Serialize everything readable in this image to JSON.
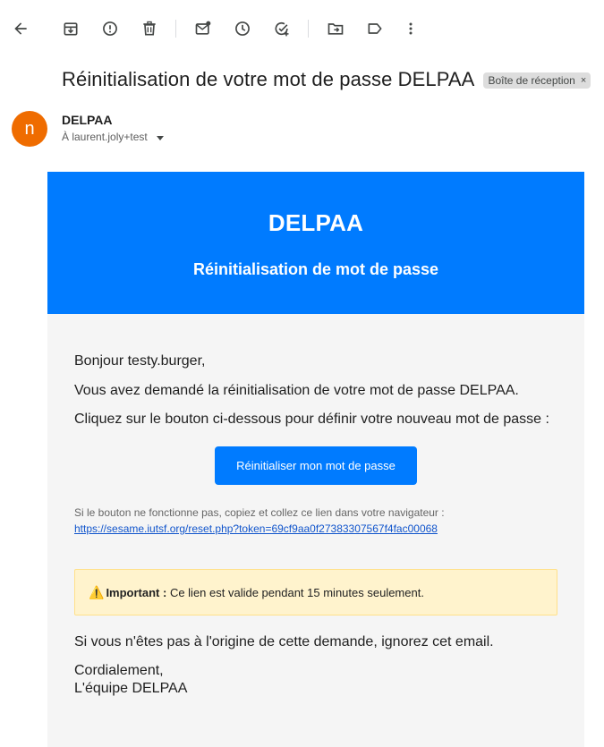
{
  "toolbar": {
    "back": "back-arrow-icon",
    "archive": "archive-icon",
    "report": "report-spam-icon",
    "delete": "trash-icon",
    "mark_unread": "mark-unread-icon",
    "snooze": "snooze-icon",
    "add_task": "add-task-icon",
    "move": "move-to-icon",
    "labels": "label-icon",
    "more": "more-vert-icon"
  },
  "message": {
    "subject": "Réinitialisation de votre mot de passe DELPAA",
    "label_chip": "Boîte de réception",
    "chip_close": "×",
    "avatar_letter": "n",
    "avatar_color": "#ef6c00",
    "sender": "DELPAA",
    "to": "À laurent.joly+test"
  },
  "email": {
    "brand": "DELPAA",
    "heading": "Réinitialisation de mot de passe",
    "greeting": "Bonjour testy.burger,",
    "line1": "Vous avez demandé la réinitialisation de votre mot de passe DELPAA.",
    "line2": "Cliquez sur le bouton ci-dessous pour définir votre nouveau mot de passe :",
    "button": "Réinitialiser mon mot de passe",
    "fallback_text": "Si le bouton ne fonctionne pas, copiez et collez ce lien dans votre navigateur :",
    "fallback_link": "https://sesame.iutsf.org/reset.php?token=69cf9aa0f27383307567f4fac00068",
    "notice_icon": "⚠️",
    "notice_bold": "Important :",
    "notice_text": " Ce lien est valide pendant 15 minutes seulement.",
    "ignore": "Si vous n'êtes pas à l'origine de cette demande, ignorez cet email.",
    "closing": "Cordialement,",
    "signature": "L'équipe DELPAA"
  },
  "colors": {
    "brand_blue": "#007bff",
    "notice_bg": "#fff3cd",
    "body_bg": "#f5f5f5"
  }
}
